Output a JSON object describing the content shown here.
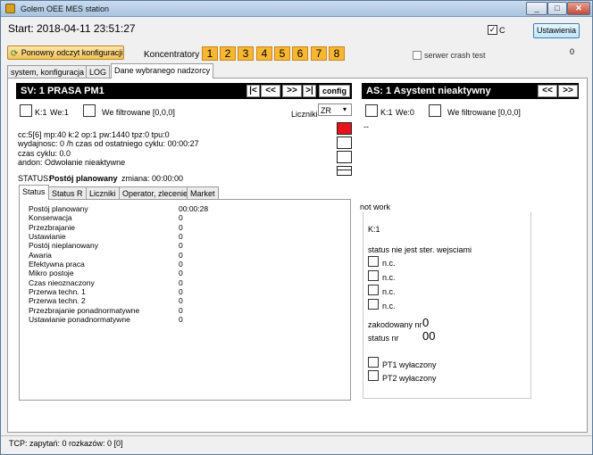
{
  "window": {
    "title": "Golem OEE MES station",
    "buttons": [
      "_",
      "□",
      "✕"
    ]
  },
  "start_label": "Start: 2018-04-11 23:51:27",
  "c_checkbox": {
    "label": "C",
    "checked": true
  },
  "settings_label": "Ustawienia",
  "reload_label": "Ponowny odczyt konfiguracji",
  "concentrators_label": "Koncentratory",
  "concentrators": [
    "1",
    "2",
    "3",
    "4",
    "5",
    "6",
    "7",
    "8"
  ],
  "crash_label": "serwer crash test",
  "right_count": "0",
  "main_tabs": [
    "system, konfiguracja",
    "LOG",
    "Dane wybranego nadzorcy"
  ],
  "sv": {
    "title": "SV: 1  PRASA PM1",
    "nav": [
      "|<",
      "<<",
      ">>",
      ">|"
    ],
    "config_label": "config",
    "k_label": "K:1",
    "we_label": "We:1",
    "we_filtered": "We filtrowane [0,0,0]",
    "counters_label": "Liczniki",
    "counters_value": "ZR",
    "info_lines": [
      "cc:5[6]   mp:40   k:2 op:1   pw:1440  tpz:0  tpu:0",
      "wydajnosc: 0 /h czas od ostatniego cyklu: 00:00:27",
      "czas cyklu: 0.0",
      "andon: Odwołanie nieaktywne"
    ],
    "status_label": "STATUS:",
    "status_value": "Postój planowany",
    "shift_label": "zmiana: 00:00:00",
    "indicator_colors": [
      "#e8121b",
      "#ffffff",
      "#ffffff",
      "#ffffff"
    ],
    "tabs": [
      "Status",
      "Status R",
      "Liczniki",
      "Operator, zlecenie",
      "Market"
    ],
    "status_rows": [
      {
        "label": "Postój planowany",
        "value": "00:00:28"
      },
      {
        "label": "Konserwacja",
        "value": "0"
      },
      {
        "label": "Przezbrajanie",
        "value": "0"
      },
      {
        "label": "Ustawianie",
        "value": "0"
      },
      {
        "label": "Postój nieplanowany",
        "value": "0"
      },
      {
        "label": "Awaria",
        "value": "0"
      },
      {
        "label": "Efektywna praca",
        "value": "0"
      },
      {
        "label": "Mikro postoje",
        "value": "0"
      },
      {
        "label": "Czas nieoznaczony",
        "value": "0"
      },
      {
        "label": "Przerwa techn. 1",
        "value": "0"
      },
      {
        "label": "Przerwa techn. 2",
        "value": "0"
      },
      {
        "label": "Przezbrajanie ponadnormatywne",
        "value": "0"
      },
      {
        "label": "Ustawianie ponadnormatywne",
        "value": "0"
      }
    ]
  },
  "as": {
    "title": "AS: 1  Asystent nieaktywny",
    "nav": [
      "<<",
      ">>"
    ],
    "k_label": "K:1",
    "we_label": "We:0",
    "we_filtered": "We filtrowane [0,0,0]",
    "dash": "--"
  },
  "notwork": {
    "label": "not work",
    "k_label": "K:1",
    "status_note": "status nie jest ster. wejsciami",
    "nc_items": [
      "n.c.",
      "n.c.",
      "n.c.",
      "n.c."
    ],
    "coded_label": "zakodowany nr",
    "coded_value": "0",
    "status_nr_label": "status nr",
    "status_nr_value": "00",
    "pt1_label": "PT1 wyłaczony",
    "pt2_label": "PT2 wyłaczony"
  },
  "footer": "TCP: zapytań: 0  rozkazów: 0  [0]"
}
